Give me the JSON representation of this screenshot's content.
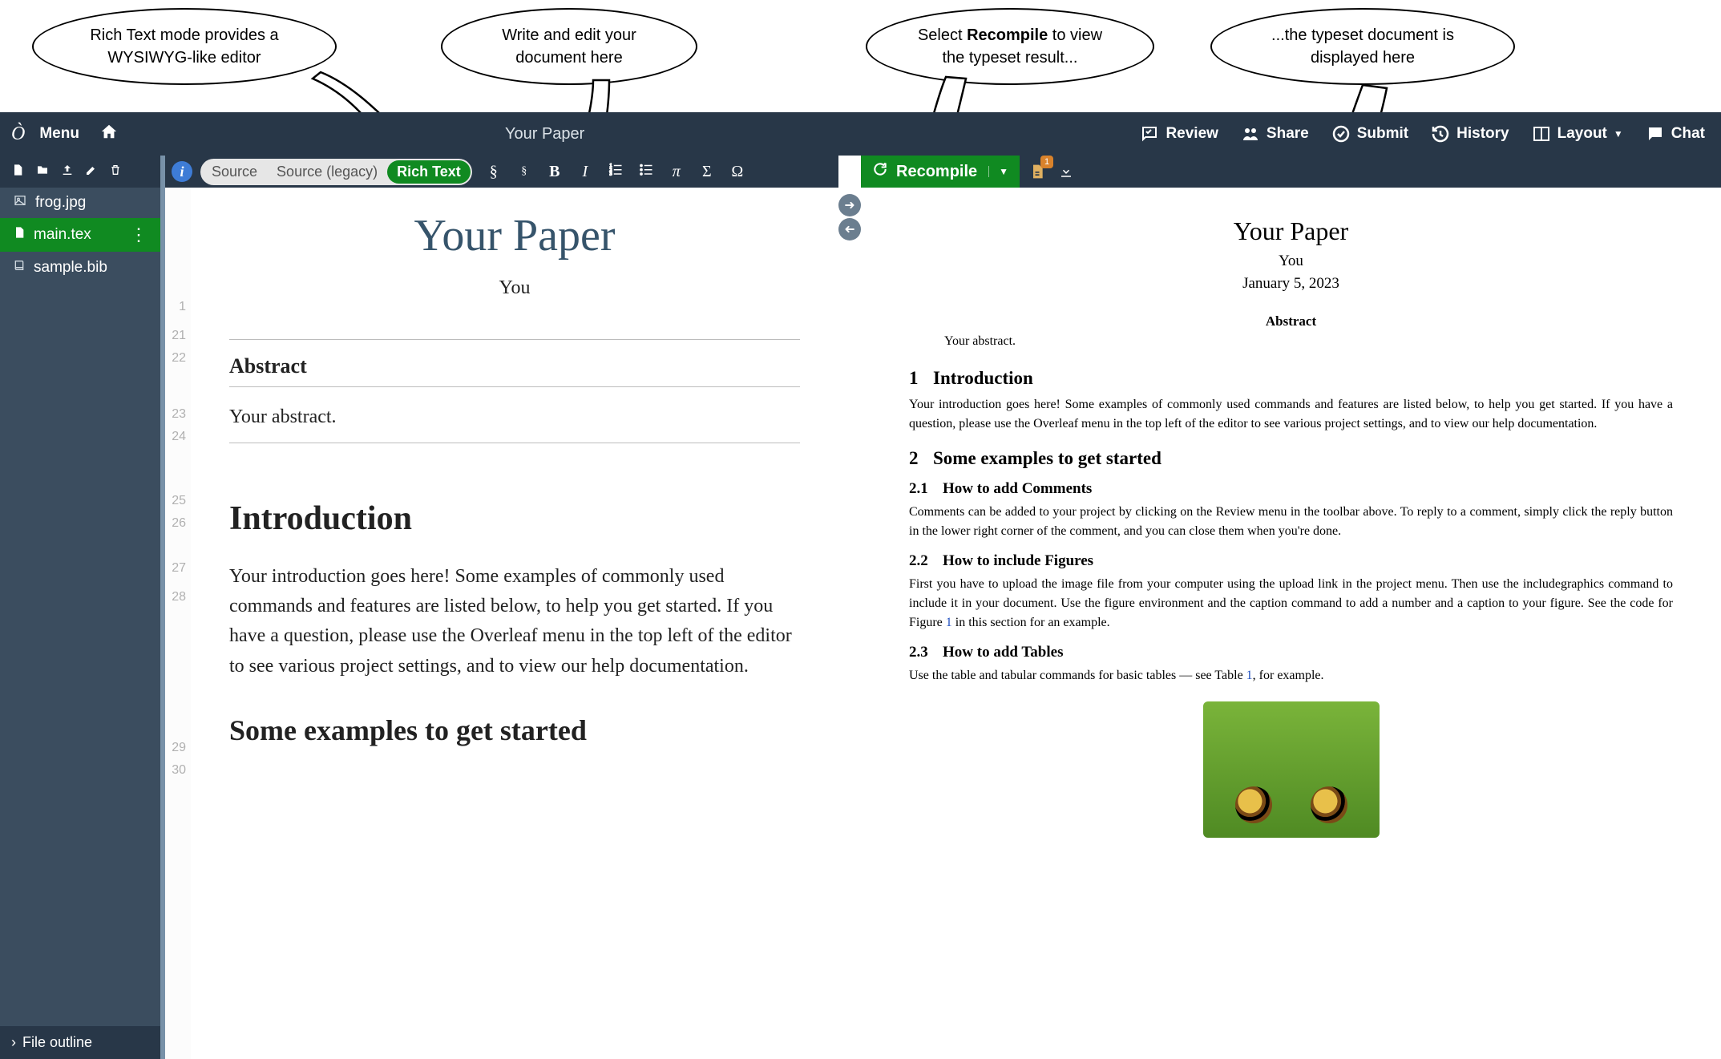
{
  "annotations": {
    "rich_text": "Rich Text mode provides a WYSIWYG-like editor",
    "write_edit": "Write and edit your document here",
    "recompile_hint_pre": "Select ",
    "recompile_hint_bold": "Recompile",
    "recompile_hint_post": " to view the typeset result...",
    "typeset": "...the typeset document is displayed here"
  },
  "header": {
    "menu": "Menu",
    "title": "Your Paper",
    "review": "Review",
    "share": "Share",
    "submit": "Submit",
    "history": "History",
    "layout": "Layout",
    "chat": "Chat"
  },
  "files": {
    "items": [
      {
        "name": "frog.jpg",
        "icon": "image"
      },
      {
        "name": "main.tex",
        "icon": "file",
        "active": true
      },
      {
        "name": "sample.bib",
        "icon": "book"
      }
    ],
    "outline": "File outline"
  },
  "editor": {
    "modes": {
      "source": "Source",
      "source_legacy": "Source (legacy)",
      "rich_text": "Rich Text"
    },
    "gutter": [
      "1",
      "21",
      "22",
      "23",
      "24",
      "25",
      "26",
      "27",
      "28",
      "29",
      "30"
    ],
    "doc": {
      "title": "Your Paper",
      "author": "You",
      "abstract_head": "Abstract",
      "abstract_text": "Your abstract.",
      "section1": "Introduction",
      "intro_body": "Your introduction goes here! Some examples of commonly used commands and features are listed below, to help you get started. If you have a question, please use the Overleaf menu in the top left of the editor to see various project settings, and to view our help documentation.",
      "section2": "Some examples to get started"
    }
  },
  "pdf": {
    "recompile": "Recompile",
    "logs_badge": "1",
    "page": {
      "title": "Your Paper",
      "author": "You",
      "date": "January 5, 2023",
      "abstract_head": "Abstract",
      "abstract_text": "Your abstract.",
      "sec1_num": "1",
      "sec1": "Introduction",
      "sec1_body": "Your introduction goes here! Some examples of commonly used commands and features are listed below, to help you get started. If you have a question, please use the Overleaf menu in the top left of the editor to see various project settings, and to view our help documentation.",
      "sec2_num": "2",
      "sec2": "Some examples to get started",
      "sub21_num": "2.1",
      "sub21": "How to add Comments",
      "sub21_body": "Comments can be added to your project by clicking on the Review menu in the toolbar above. To reply to a comment, simply click the reply button in the lower right corner of the comment, and you can close them when you're done.",
      "sub22_num": "2.2",
      "sub22": "How to include Figures",
      "sub22_body_a": "First you have to upload the image file from your computer using the upload link in the project menu. Then use the includegraphics command to include it in your document. Use the figure environment and the caption command to add a number and a caption to your figure. See the code for Figure ",
      "sub22_link": "1",
      "sub22_body_b": " in this section for an example.",
      "sub23_num": "2.3",
      "sub23": "How to add Tables",
      "sub23_body_a": "Use the table and tabular commands for basic tables — see Table ",
      "sub23_link": "1",
      "sub23_body_b": ", for example."
    }
  }
}
